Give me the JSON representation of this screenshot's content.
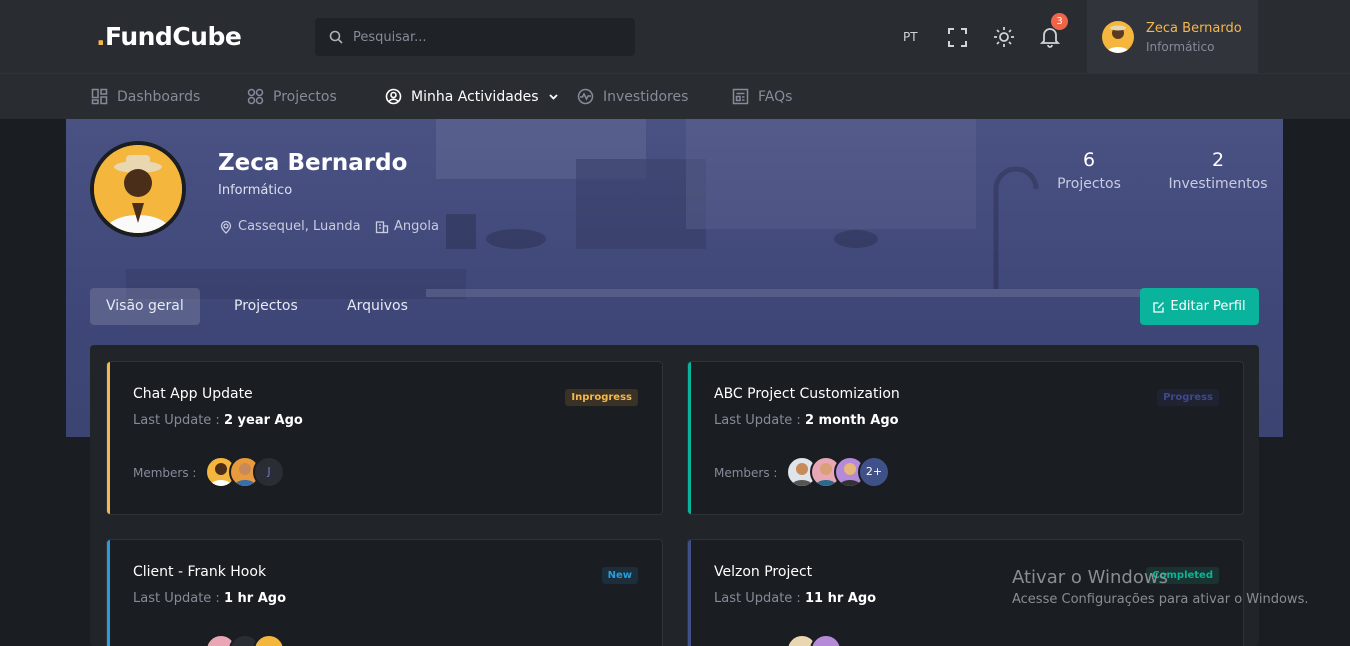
{
  "brand": {
    "logo_dot": ".",
    "logo_text": "FundCube"
  },
  "search": {
    "placeholder": "Pesquisar..."
  },
  "topbar": {
    "language": "PT",
    "notifications_count": "3",
    "user_name": "Zeca Bernardo",
    "user_role": "Informático"
  },
  "nav": [
    {
      "label": "Dashboards",
      "icon": "dashboard-icon",
      "active": false
    },
    {
      "label": "Projectos",
      "icon": "apps-icon",
      "active": false
    },
    {
      "label": "Minha Actividades",
      "icon": "user-circle-icon",
      "active": true
    },
    {
      "label": "Investidores",
      "icon": "pulse-icon",
      "active": false
    },
    {
      "label": "FAQs",
      "icon": "newspaper-icon",
      "active": false
    }
  ],
  "profile": {
    "name": "Zeca Bernardo",
    "role": "Informático",
    "location": "Cassequel, Luanda",
    "country": "Angola",
    "stats": [
      {
        "value": "6",
        "label": "Projectos"
      },
      {
        "value": "2",
        "label": "Investimentos"
      }
    ]
  },
  "tabs": [
    "Visão geral",
    "Projectos",
    "Arquivos"
  ],
  "edit_button": "Editar Perfil",
  "projects": [
    {
      "title": "Chat App Update",
      "update_prefix": "Last Update :",
      "update_value": "2 year Ago",
      "status": "Inprogress",
      "members_label": "Members :",
      "bar_color": "#f7b84b",
      "status_color": "#f7b84b",
      "status_bg": "#3a3224",
      "extra": "J"
    },
    {
      "title": "ABC Project Customization",
      "update_prefix": "Last Update :",
      "update_value": "2 month Ago",
      "status": "Progress",
      "members_label": "Members :",
      "bar_color": "#0ab39c",
      "status_color": "#3d4a8a",
      "status_bg": "#1f2231",
      "extra": "2+"
    },
    {
      "title": "Client - Frank Hook",
      "update_prefix": "Last Update :",
      "update_value": "1 hr Ago",
      "status": "New",
      "members_label": "",
      "bar_color": "#299cdb",
      "status_color": "#299cdb",
      "status_bg": "#1c2d3b",
      "extra": ""
    },
    {
      "title": "Velzon Project",
      "update_prefix": "Last Update :",
      "update_value": "11 hr Ago",
      "status": "Completed",
      "members_label": "",
      "bar_color": "#405189",
      "status_color": "#0ab39c",
      "status_bg": "#193430",
      "extra": ""
    }
  ],
  "watermark": {
    "line1": "Ativar o Windows",
    "line2": "Acesse Configurações para ativar o Windows."
  }
}
